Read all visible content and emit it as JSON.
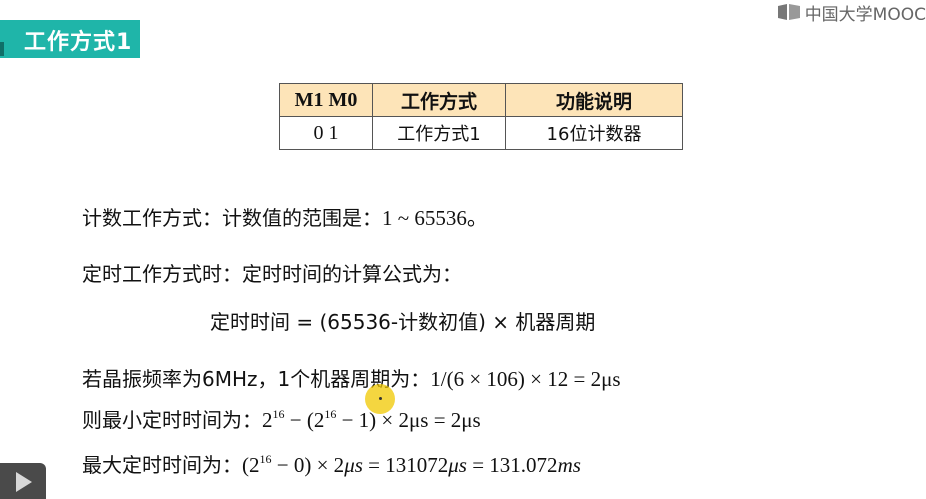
{
  "banner": {
    "title": "工作方式1"
  },
  "logo": {
    "text": "中国大学MOOC"
  },
  "table": {
    "headers": [
      "M1 M0",
      "工作方式",
      "功能说明"
    ],
    "row": [
      "0 1",
      "工作方式1",
      "16位计数器"
    ]
  },
  "lines": {
    "count_prefix": "计数工作方式：计数值的范围是：",
    "count_range": "1 ~ 65536。",
    "timer_intro": "定时工作方式时：定时时间的计算公式为：",
    "formula": "定时时间 = (65536-计数初值) × 机器周期",
    "osc_prefix": "若晶振频率为6MHz，1个机器周期为：",
    "osc_value": "1/(6 × 106) × 12 = 2μs",
    "min_prefix": "则最小定时时间为：",
    "min_a": "2",
    "min_exp1": "16",
    "min_b": " − (2",
    "min_exp2": "16",
    "min_c": " − 1) × 2μs = 2μs",
    "max_prefix": "最大定时时间为：",
    "max_a": "(2",
    "max_exp": "16",
    "max_b": " − 0) × 2",
    "max_unit1": "μs",
    "max_c": " = 131072",
    "max_unit2": "μs",
    "max_d": " = 131.072",
    "max_unit3": "ms"
  },
  "icons": {
    "play": "play-icon",
    "logo": "mooc-logo-icon"
  },
  "colors": {
    "banner": "#1fb5a9",
    "table_header": "#fde4b8"
  }
}
